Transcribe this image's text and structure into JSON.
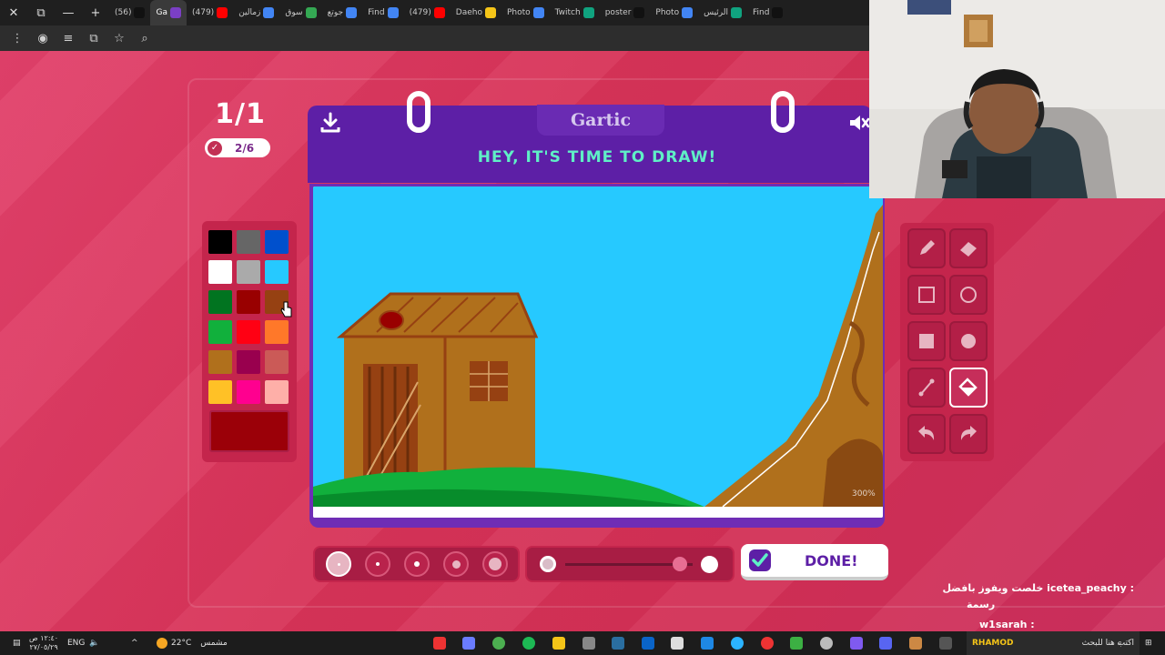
{
  "browser": {
    "tabs": [
      {
        "label": "(56)",
        "color": "#111111",
        "active": false
      },
      {
        "label": "Ga",
        "color": "#7b3fc4",
        "active": true
      },
      {
        "label": "(479)",
        "color": "#ff0000",
        "active": false
      },
      {
        "label": "زمالين",
        "color": "#4285f4",
        "active": false
      },
      {
        "label": "سوق",
        "color": "#34a853",
        "active": false
      },
      {
        "label": "جوتع",
        "color": "#4285f4",
        "active": false
      },
      {
        "label": "Find",
        "color": "#4285f4",
        "active": false
      },
      {
        "label": "(479)",
        "color": "#ff0000",
        "active": false
      },
      {
        "label": "Daeho",
        "color": "#f5c518",
        "active": false
      },
      {
        "label": "Photo",
        "color": "#4285f4",
        "active": false
      },
      {
        "label": "Twitch",
        "color": "#10a37f",
        "active": false
      },
      {
        "label": "poster",
        "color": "#111111",
        "active": false
      },
      {
        "label": "Photo",
        "color": "#4285f4",
        "active": false
      },
      {
        "label": "الرئيس",
        "color": "#10a37f",
        "active": false
      },
      {
        "label": "Find",
        "color": "#111111",
        "active": false
      }
    ]
  },
  "game": {
    "round": "1/1",
    "progress": "2/6",
    "logo": "Gartic",
    "title": "HEY, IT'S TIME TO DRAW!",
    "zoom": "300%",
    "done_label": "DONE!",
    "opacity_level": 0.9,
    "selected_tool": "fill",
    "selected_brush_size": 1,
    "current_color": "#9b0008",
    "palette": [
      "#000000",
      "#666666",
      "#0050cd",
      "#ffffff",
      "#aaaaaa",
      "#26c9ff",
      "#017420",
      "#990000",
      "#964112",
      "#11b03c",
      "#ff0013",
      "#ff7829",
      "#b0701c",
      "#99004e",
      "#cb5a57",
      "#ffc126",
      "#ff008f",
      "#feafa8"
    ]
  },
  "chat": {
    "line1_user": "icetea_peachy :",
    "line1_text": "خلصت ويفوز بافضل",
    "line1_cont": "رسمة",
    "line2_user": "w1sarah :",
    "line3_user": "RHAMOD",
    "line3_text": "اكتب هنا للبحث"
  },
  "taskbar": {
    "time": "١٢:٤٠ ص",
    "date": "٢٧/٠٥/٢٩",
    "lang": "ENG",
    "weather_temp": "22°C",
    "weather_text": "مشمس"
  }
}
